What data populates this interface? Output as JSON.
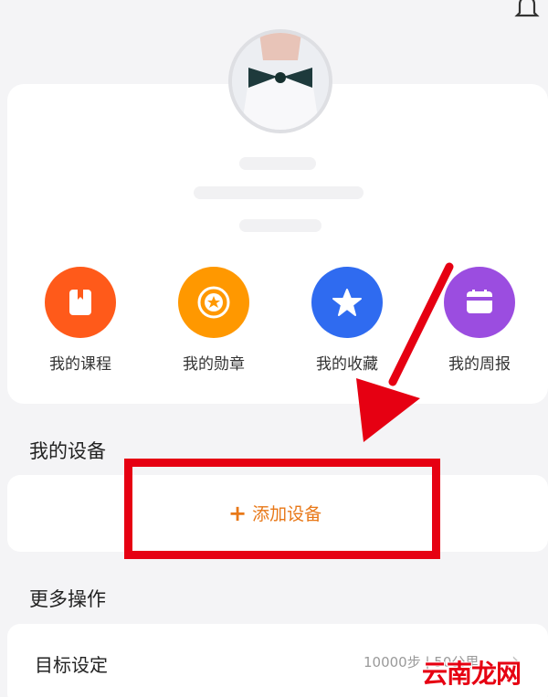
{
  "header": {
    "bell_icon": "bell-icon"
  },
  "profile": {
    "avatar": "avatar-photo"
  },
  "shortcuts": [
    {
      "label": "我的课程",
      "icon": "course-book-icon",
      "color": "#ff5a1a"
    },
    {
      "label": "我的勋章",
      "icon": "medal-star-icon",
      "color": "#ff9800"
    },
    {
      "label": "我的收藏",
      "icon": "star-icon",
      "color": "#2f6bf0"
    },
    {
      "label": "我的周报",
      "icon": "weekly-report-icon",
      "color": "#9b4de0"
    }
  ],
  "devices": {
    "title": "我的设备",
    "add_label": "添加设备",
    "add_icon": "plus",
    "accent": "#e87818"
  },
  "more": {
    "title": "更多操作",
    "goal_label": "目标设定",
    "goal_value": "10000步 | 50公里"
  },
  "annotation": {
    "highlight_color": "#e60012"
  },
  "watermark": "云南龙网"
}
